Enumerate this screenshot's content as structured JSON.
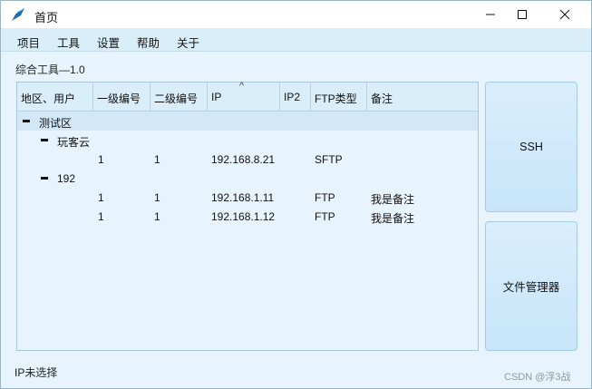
{
  "window": {
    "title": "首页",
    "icon": "app-feather-icon"
  },
  "menu": [
    "项目",
    "工具",
    "设置",
    "帮助",
    "关于"
  ],
  "caption": "综合工具—1.0",
  "tree": {
    "columns": [
      "地区、用户",
      "一级编号",
      "二级编号",
      "IP",
      "IP2",
      "FTP类型",
      "备注"
    ],
    "sort_indicator": "^",
    "rows": [
      {
        "level": 0,
        "label": "测试区",
        "expanded": true,
        "selected": true
      },
      {
        "level": 1,
        "label": "玩客云",
        "expanded": true
      },
      {
        "level": 2,
        "cells": [
          "",
          "1",
          "1",
          "192.168.8.21",
          "",
          "SFTP",
          ""
        ]
      },
      {
        "level": 1,
        "label": "192",
        "expanded": true
      },
      {
        "level": 2,
        "cells": [
          "",
          "1",
          "1",
          "192.168.1.11",
          "",
          "FTP",
          "我是备注"
        ]
      },
      {
        "level": 2,
        "cells": [
          "",
          "1",
          "1",
          "192.168.1.12",
          "",
          "FTP",
          "我是备注"
        ]
      }
    ]
  },
  "buttons": {
    "ssh": "SSH",
    "file_manager": "文件管理器"
  },
  "status": "IP未选择",
  "watermark": "CSDN @浮3战"
}
